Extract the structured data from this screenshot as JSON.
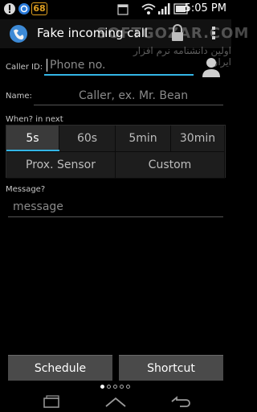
{
  "status_bar": {
    "badge": "68",
    "time": "5:05 PM"
  },
  "action_bar": {
    "title": "Fake incoming call",
    "watermark": "SOFTGOZAR.COM",
    "watermark_sub": "اولین دانشنامه نرم افزار ایران"
  },
  "form": {
    "caller_id_label": "Caller ID:",
    "phone_placeholder": "Phone no.",
    "name_label": "Name:",
    "name_placeholder": "Caller, ex. Mr. Bean",
    "when_label": "When? in next",
    "time_options": [
      "5s",
      "60s",
      "5min",
      "30min"
    ],
    "selected_time": "5s",
    "extra_options": [
      "Prox. Sensor",
      "Custom"
    ],
    "message_label": "Message?",
    "message_placeholder": "message"
  },
  "buttons": {
    "schedule": "Schedule",
    "shortcut": "Shortcut"
  },
  "pager": {
    "count": 5,
    "active_index": 0
  },
  "colors": {
    "accent": "#33b5e5",
    "background": "#000000"
  }
}
